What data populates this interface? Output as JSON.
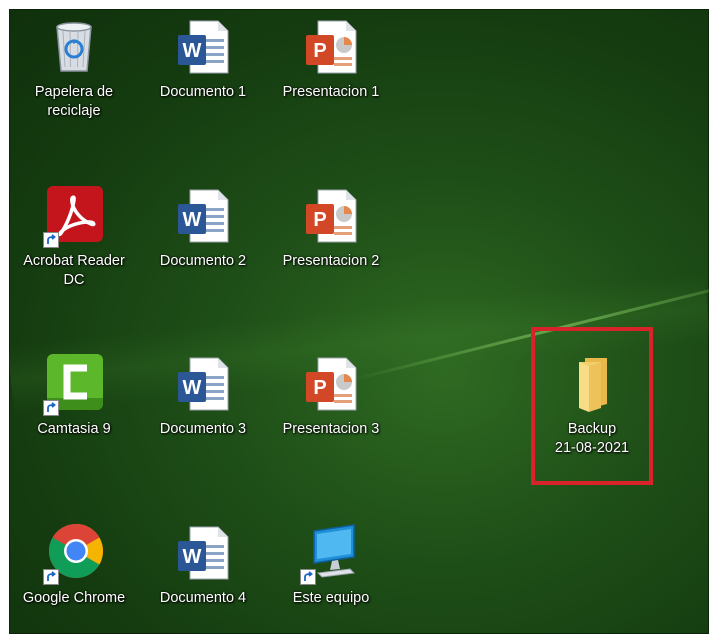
{
  "desktop": {
    "icons": [
      {
        "id": "recycle-bin",
        "label": "Papelera de\nreciclaje",
        "icon": "recycle-bin-icon"
      },
      {
        "id": "documento-1",
        "label": "Documento 1",
        "icon": "word-document-icon"
      },
      {
        "id": "presentacion-1",
        "label": "Presentacion 1",
        "icon": "powerpoint-icon"
      },
      {
        "id": "acrobat-reader",
        "label": "Acrobat Reader\nDC",
        "icon": "acrobat-reader-icon"
      },
      {
        "id": "documento-2",
        "label": "Documento 2",
        "icon": "word-document-icon"
      },
      {
        "id": "presentacion-2",
        "label": "Presentacion 2",
        "icon": "powerpoint-icon"
      },
      {
        "id": "camtasia",
        "label": "Camtasia 9",
        "icon": "camtasia-icon"
      },
      {
        "id": "documento-3",
        "label": "Documento 3",
        "icon": "word-document-icon"
      },
      {
        "id": "presentacion-3",
        "label": "Presentacion 3",
        "icon": "powerpoint-icon"
      },
      {
        "id": "backup-folder",
        "label": "Backup\n21-08-2021",
        "icon": "folder-icon"
      },
      {
        "id": "google-chrome",
        "label": "Google Chrome",
        "icon": "chrome-icon"
      },
      {
        "id": "documento-4",
        "label": "Documento 4",
        "icon": "word-document-icon"
      },
      {
        "id": "este-equipo",
        "label": "Este equipo",
        "icon": "computer-icon"
      }
    ],
    "highlight_color": "#d8232a",
    "wallpaper_color": "#1f5018"
  }
}
